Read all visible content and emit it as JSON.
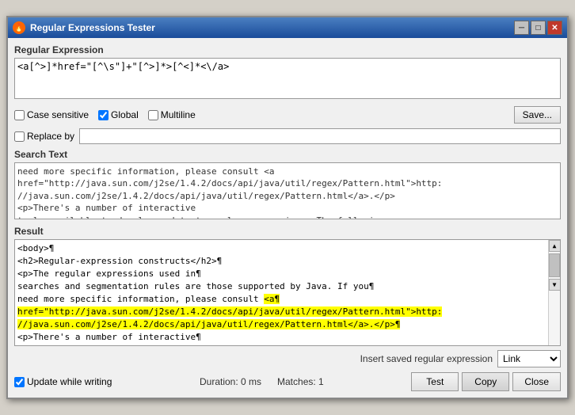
{
  "window": {
    "title": "Regular Expressions Tester",
    "icon": "🔥"
  },
  "titlebar_buttons": {
    "minimize": "─",
    "maximize": "□",
    "close": "✕"
  },
  "sections": {
    "regex_label": "Regular Expression",
    "search_label": "Search Text",
    "result_label": "Result"
  },
  "regex_value": "<a[^>]*href=\"[^\\s\"]+\"[^>]*>[^<]*<\\/a>",
  "options": {
    "case_sensitive": "Case sensitive",
    "global": "Global",
    "multiline": "Multiline",
    "case_sensitive_checked": false,
    "global_checked": true,
    "multiline_checked": false
  },
  "save_button": "Save...",
  "replace_by_label": "Replace by",
  "replace_value": "",
  "search_text": "need more specific information, please consult <a\nhref=\"http://java.sun.com/j2se/1.4.2/docs/api/java/util/regex/Pattern.html\">http:\n//java.sun.com/j2se/1.4.2/docs/api/java/util/regex/Pattern.html</a>.</p>\n<p>There's a number of interactive\ntools available to develop and test regular expressions. The following",
  "result_lines": [
    "<body>¶",
    "<h2>Regular-expression constructs</h2>¶",
    "<p>The regular expressions used in¶",
    "searches and segmentation rules are those supported by Java. If you¶",
    "need more specific information, please consult <a¶",
    "href=\"http://java.sun.com/j2se/1.4.2/docs/api/java/util/regex/Pattern.html\">http:",
    "//java.sun.com/j2se/1.4.2/docs/api/java/util/regex/Pattern.html</a>.</p>¶",
    "<p>There's a number of interactive¶"
  ],
  "highlighted_start_line": 5,
  "highlighted_end_line": 7,
  "bottom": {
    "insert_label": "Insert saved regular expression",
    "insert_value": "Link",
    "insert_options": [
      "Link"
    ],
    "update_while_writing": "Update while writing",
    "update_checked": true,
    "duration_label": "Duration: 0 ms",
    "matches_label": "Matches: 1"
  },
  "buttons": {
    "test": "Test",
    "copy": "Copy",
    "close": "Close"
  }
}
